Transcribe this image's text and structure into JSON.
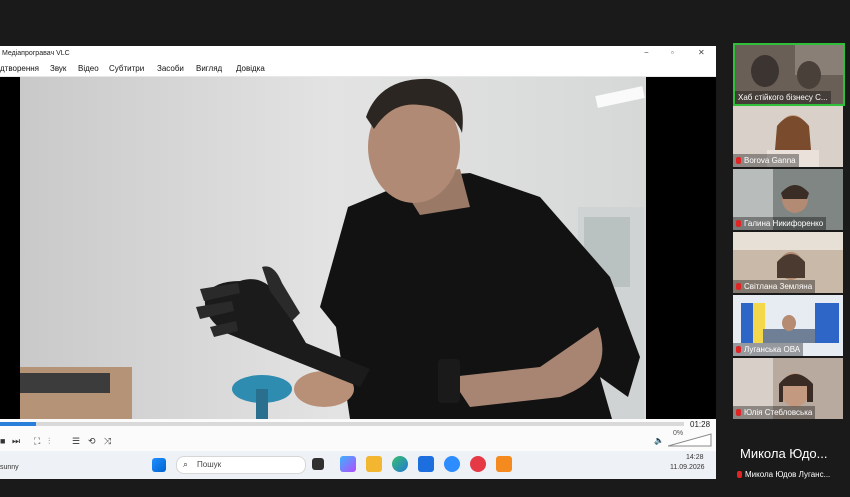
{
  "vlc": {
    "title": "Медіапрогравач VLC",
    "window_controls": [
      "−",
      "▫",
      "✕"
    ],
    "menu": [
      "дтворення",
      "Звук",
      "Відео",
      "Субтитри",
      "Засоби",
      "Вигляд",
      "Довідка"
    ],
    "time_remaining": "01:28",
    "volume": "0%"
  },
  "taskbar": {
    "weather": "sunny",
    "search_placeholder": "Пошук",
    "time": "14:28",
    "date": "11.09.2026"
  },
  "participants": [
    {
      "name": "Хаб стійкого бізнесу С...",
      "muted": false,
      "active": true
    },
    {
      "name": "Borova Ganna",
      "muted": true
    },
    {
      "name": "Галина Никифоренко",
      "muted": true
    },
    {
      "name": "Світлана  Земляна",
      "muted": true
    },
    {
      "name": "Луганська ОВА",
      "muted": true
    },
    {
      "name": "Юлія Стебловська",
      "muted": true
    }
  ],
  "active_speaker": {
    "display": "Микола Юдо...",
    "full": "Микола Юдов Луганс..."
  }
}
